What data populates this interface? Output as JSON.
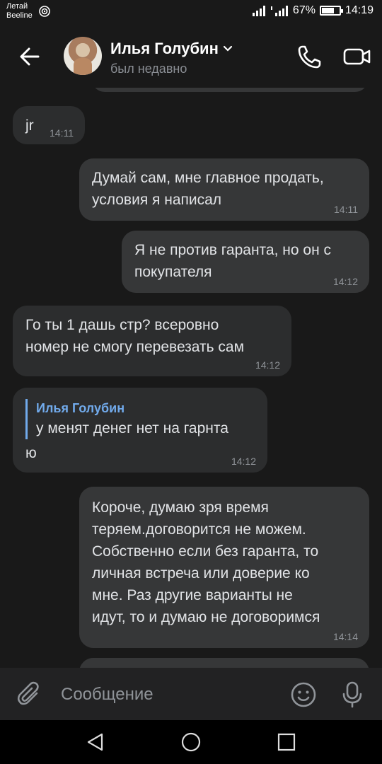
{
  "status_bar": {
    "carrier_line1": "Летай",
    "carrier_line2": "Beeline",
    "battery_percent": "67%",
    "battery_level": 0.67,
    "time": "14:19"
  },
  "header": {
    "contact_name": "Илья Голубин",
    "contact_status": "был недавно"
  },
  "messages": [
    {
      "direction": "in",
      "text": "jr",
      "time": "14:11"
    },
    {
      "direction": "out",
      "text": "Думай сам, мне главное продать,\nусловия я написал",
      "time": "14:11"
    },
    {
      "direction": "out",
      "text": "Я не против гаранта, но он с\nпокупателя",
      "time": "14:12"
    },
    {
      "direction": "in",
      "text": "Го ты 1 дашь стр? всеровно\nномер не смогу перевезать сам",
      "time": "14:12"
    },
    {
      "direction": "in",
      "reply_name": "Илья Голубин",
      "reply_text": "у менят денег нет на гарнта",
      "text": "ю",
      "time": "14:12"
    },
    {
      "direction": "out",
      "text": "Короче, думаю зря время\nтеряем.договорится не можем.\nСобственно если без гаранта, то\nличная встреча или доверие ко\nмне. Раз другие варианты не\nидут, то и думаю не договоримся",
      "time": "14:14"
    }
  ],
  "input": {
    "placeholder": "Сообщение"
  },
  "colors": {
    "accent": "#71aaeb",
    "background": "#191919",
    "bubble_in": "#2c2d2e",
    "bubble_out": "#363738"
  },
  "icons": {
    "back": "arrow-left-icon",
    "call": "phone-icon",
    "video": "video-camera-icon",
    "attach": "paperclip-icon",
    "emoji": "smile-icon",
    "mic": "microphone-icon"
  }
}
